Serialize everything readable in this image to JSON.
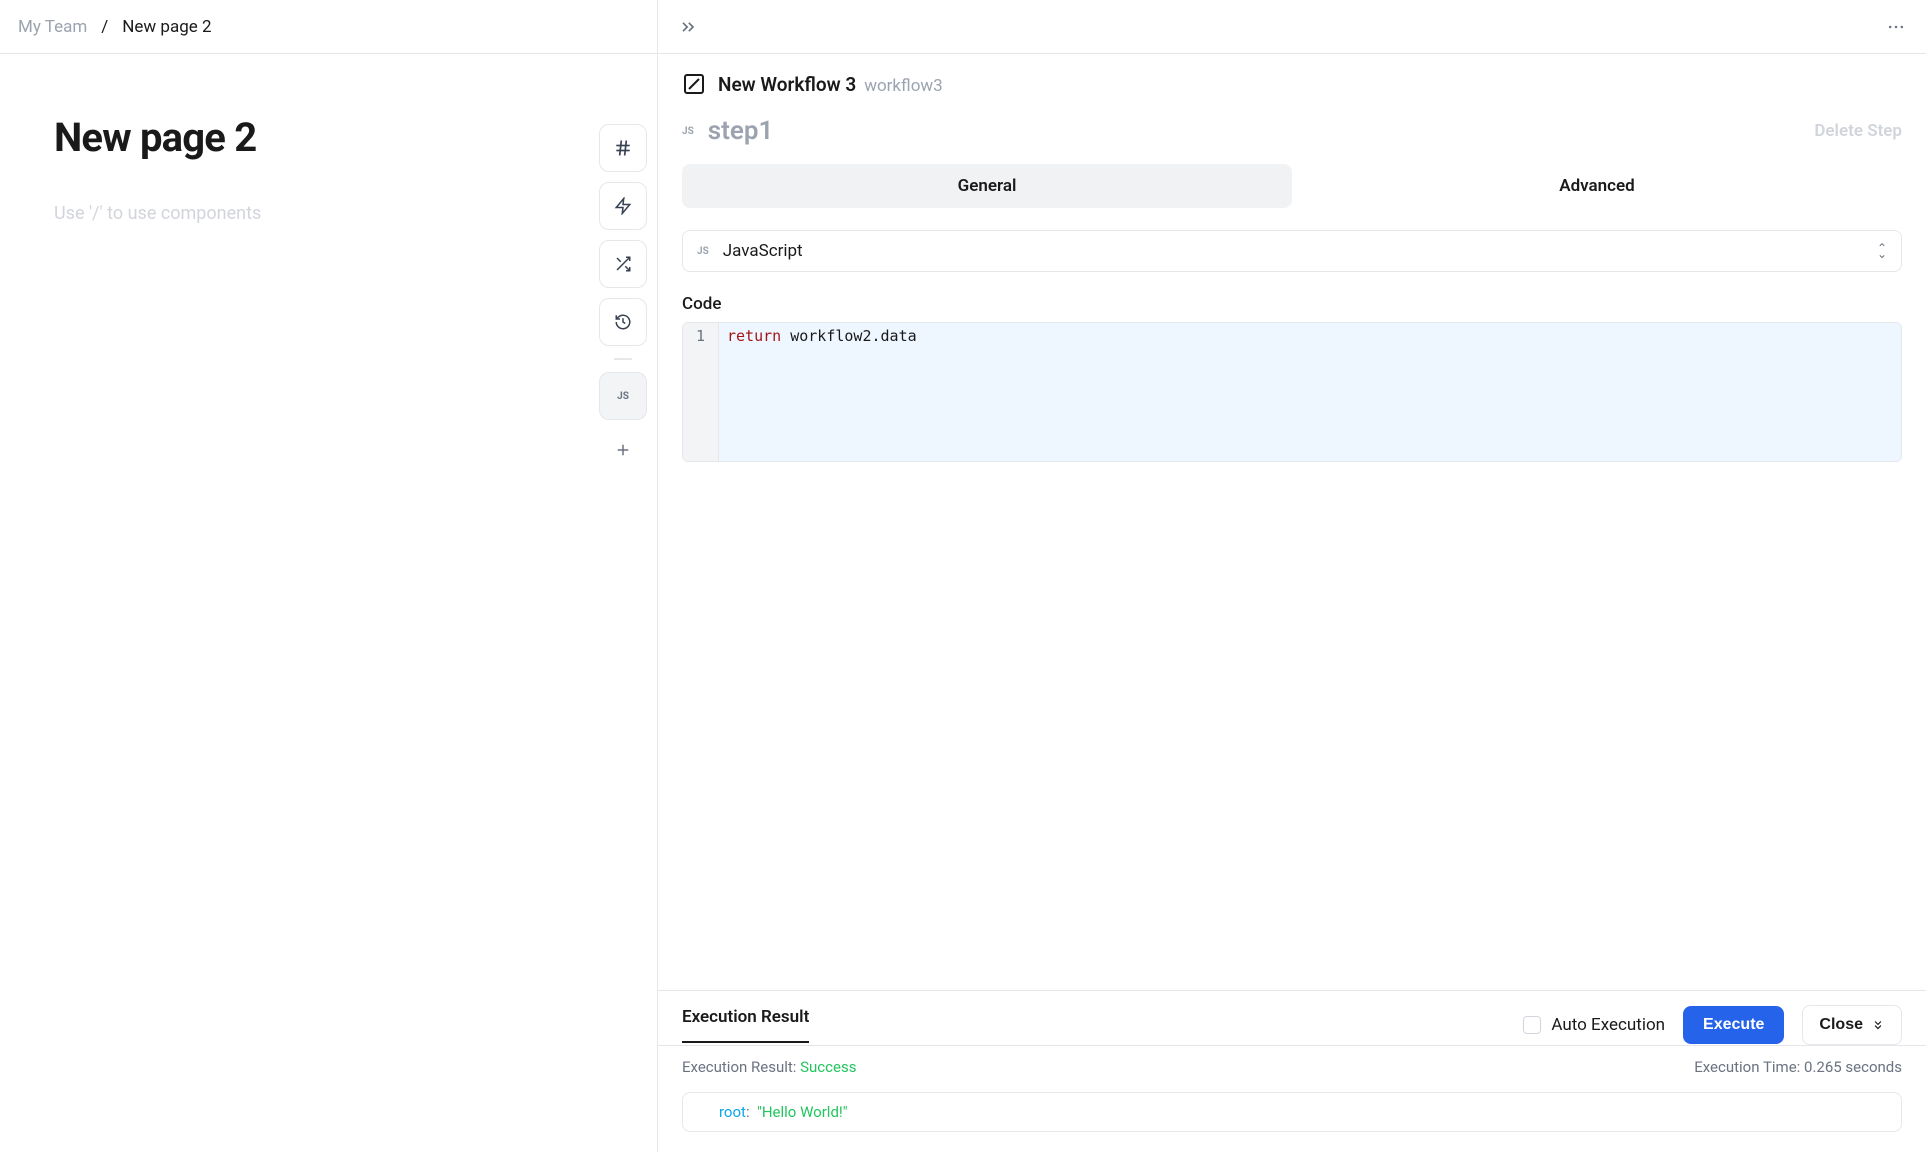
{
  "breadcrumb": {
    "team": "My Team",
    "page": "New page 2"
  },
  "page": {
    "title": "New page 2",
    "placeholder": "Use '/' to use components"
  },
  "toolbar": {
    "js_label": "JS"
  },
  "workflow": {
    "title": "New Workflow 3",
    "slug": "workflow3"
  },
  "step": {
    "js_badge": "JS",
    "name": "step1",
    "delete_label": "Delete Step"
  },
  "tabs": {
    "general": "General",
    "advanced": "Advanced"
  },
  "lang": {
    "js_badge": "JS",
    "name": "JavaScript"
  },
  "code": {
    "label": "Code",
    "line1_kw": "return",
    "line1_rest": " workflow2.data",
    "gutter1": "1"
  },
  "exec": {
    "tab_label": "Execution Result",
    "auto_label": "Auto Execution",
    "execute_label": "Execute",
    "close_label": "Close",
    "result_prefix": "Execution Result: ",
    "status": "Success",
    "time_prefix": "Execution Time: ",
    "time_value": "0.265 seconds",
    "root_key": "root",
    "root_colon": ":",
    "root_value": "\"Hello World!\""
  }
}
